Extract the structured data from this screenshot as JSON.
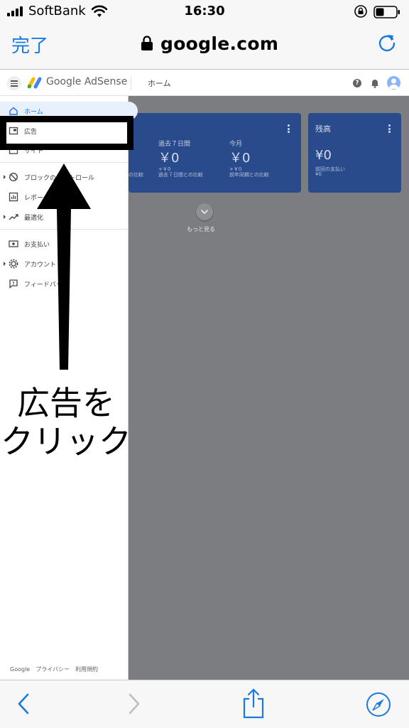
{
  "status_bar": {
    "carrier": "SoftBank",
    "time": "16:30"
  },
  "browser": {
    "done_label": "完了",
    "url": "google.com"
  },
  "adsense": {
    "logo_text": "Google AdSense",
    "header_title": "ホーム"
  },
  "sidebar": {
    "items": [
      {
        "label": "ホーム",
        "icon": "home-icon"
      },
      {
        "label": "広告",
        "icon": "ads-icon"
      },
      {
        "label": "サイト",
        "icon": "sites-icon"
      },
      {
        "label": "ブロックのコントロール",
        "icon": "block-icon"
      },
      {
        "label": "レポート",
        "icon": "report-icon"
      },
      {
        "label": "最適化",
        "icon": "optimize-icon"
      },
      {
        "label": "お支払い",
        "icon": "payment-icon"
      },
      {
        "label": "アカウント",
        "icon": "account-icon"
      },
      {
        "label": "フィードバック",
        "icon": "feedback-icon"
      }
    ],
    "footer": "Google　プライバシー　利用規約"
  },
  "cards": {
    "earnings": {
      "metric_1_label": "過去７日間",
      "metric_1_value": "￥0",
      "metric_1_sub": "+￥0",
      "metric_1_compare": "過去７日間との比較",
      "metric_2_label": "今月",
      "metric_2_value": "￥0",
      "metric_2_sub": "+￥0",
      "metric_2_compare": "前年同期との比較",
      "left_compare": "の比較"
    },
    "balance": {
      "title": "残高",
      "value": "¥0",
      "last_payment_label": "前回の支払い",
      "last_payment_value": "¥0"
    },
    "more_label": "もっと見る"
  },
  "annotation": {
    "line1": "広告を",
    "line2": "クリック"
  },
  "colors": {
    "safari_blue": "#1a7ae0",
    "card_blue": "#294b8c",
    "overlay_gray": "#7c7d80",
    "annotation_black": "#000000"
  }
}
